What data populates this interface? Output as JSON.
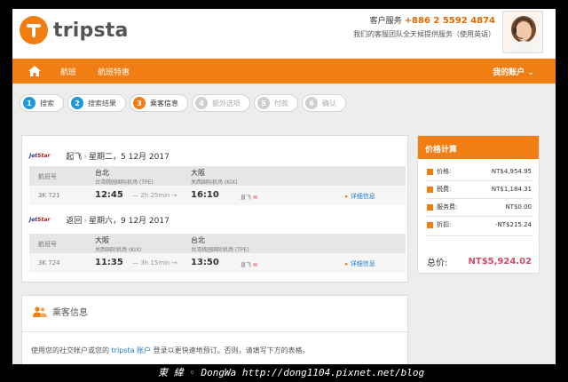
{
  "header": {
    "brand": "tripsta",
    "cs_label": "客户服务",
    "cs_phone": "+886 2 5592 4874",
    "cs_note": "我们的客服团队全天候提供服务（使用英语）"
  },
  "nav": {
    "items": [
      "航班",
      "航班特惠"
    ],
    "account": "我的账户"
  },
  "steps": [
    {
      "num": "1",
      "label": "搜索",
      "state": "done"
    },
    {
      "num": "2",
      "label": "搜索结果",
      "state": "done"
    },
    {
      "num": "3",
      "label": "乘客信息",
      "state": "active"
    },
    {
      "num": "4",
      "label": "额外选项",
      "state": "future"
    },
    {
      "num": "5",
      "label": "付款",
      "state": "future"
    },
    {
      "num": "6",
      "label": "确认",
      "state": "future"
    }
  ],
  "flights": {
    "airline_jet": "Jet",
    "airline_star": "Star",
    "col_flight": "航班号",
    "outbound": {
      "direction": "起飞",
      "date": "星期二，5 12月 2017",
      "from_city": "台北",
      "from_airport": "台湾桃园国际机场 (TPE)",
      "to_city": "大阪",
      "to_airport": "关西国际机场 (KIX)",
      "code": "3K 721",
      "depart": "12:45",
      "duration": "— 2h 25min →",
      "arrive": "16:10",
      "bag": "直飞",
      "details": "详细信息"
    },
    "return": {
      "direction": "返回",
      "date": "星期六，9 12月 2017",
      "from_city": "大阪",
      "from_airport": "关西国际机场 (KIX)",
      "to_city": "台北",
      "to_airport": "台湾桃园国际机场 (TPE)",
      "code": "3K 724",
      "depart": "11:35",
      "duration": "— 3h 15min →",
      "arrive": "13:50",
      "bag": "直飞",
      "details": "详细信息"
    }
  },
  "price": {
    "title": "价格计算",
    "rows": [
      {
        "label": "价格:",
        "value": "NT$4,954.95"
      },
      {
        "label": "税费:",
        "value": "NT$1,184.31"
      },
      {
        "label": "服务费:",
        "value": "NT$0.00"
      },
      {
        "label": "折扣:",
        "value": "-NT$215.24"
      }
    ],
    "total_label": "总价:",
    "total_value": "NT$5,924.02"
  },
  "passenger": {
    "title": "乘客信息",
    "note_pre": "使用您的社交帐户或您的",
    "note_link": "tripsta 账户",
    "note_post": "登录以更快速地预订。否则，请填写下方的表格。"
  },
  "watermark": "東 緯 ◦ DongWa http://dong1104.pixnet.net/blog",
  "colors": {
    "accent": "#f07e12",
    "step_done": "#1e9ad6",
    "link": "#1e7cc4",
    "total": "#d34a6a"
  }
}
